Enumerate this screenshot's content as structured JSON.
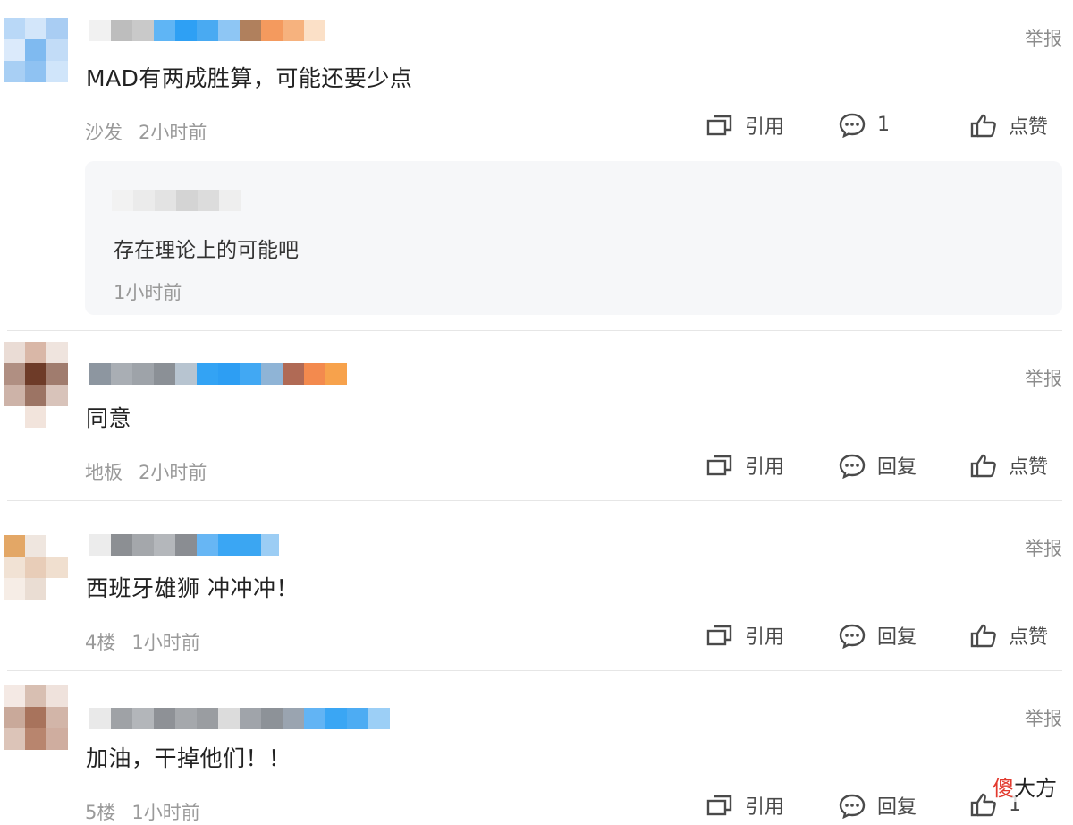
{
  "comments": [
    {
      "text": "MAD有两成胜算，可能还要少点",
      "floor": "沙发",
      "time": "2小时前",
      "report": "举报",
      "quote_label": "引用",
      "reply_count": "1",
      "like_label": "点赞",
      "reply": {
        "text": "存在理论上的可能吧",
        "time": "1小时前"
      }
    },
    {
      "text": "同意",
      "floor": "地板",
      "time": "2小时前",
      "report": "举报",
      "quote_label": "引用",
      "reply_label": "回复",
      "like_label": "点赞"
    },
    {
      "text": "西班牙雄狮 冲冲冲！",
      "floor": "4楼",
      "time": "1小时前",
      "report": "举报",
      "quote_label": "引用",
      "reply_label": "回复",
      "like_label": "点赞"
    },
    {
      "text": "加油，干掉他们！！",
      "floor": "5楼",
      "time": "1小时前",
      "report": "举报",
      "quote_label": "引用",
      "reply_label": "回复",
      "like_count": "1"
    }
  ],
  "watermark": {
    "red": "傻",
    "rest": "大方"
  },
  "icons": {
    "quote": "quote-icon",
    "comment": "comment-bubble-icon",
    "like": "thumbs-up-icon"
  },
  "colors": {
    "text": "#222222",
    "meta": "#9a9a9a",
    "action": "#4a4a4a",
    "reply_bg": "#f6f7f9",
    "divider": "#e6e6e6",
    "watermark_red": "#e23a2e"
  }
}
